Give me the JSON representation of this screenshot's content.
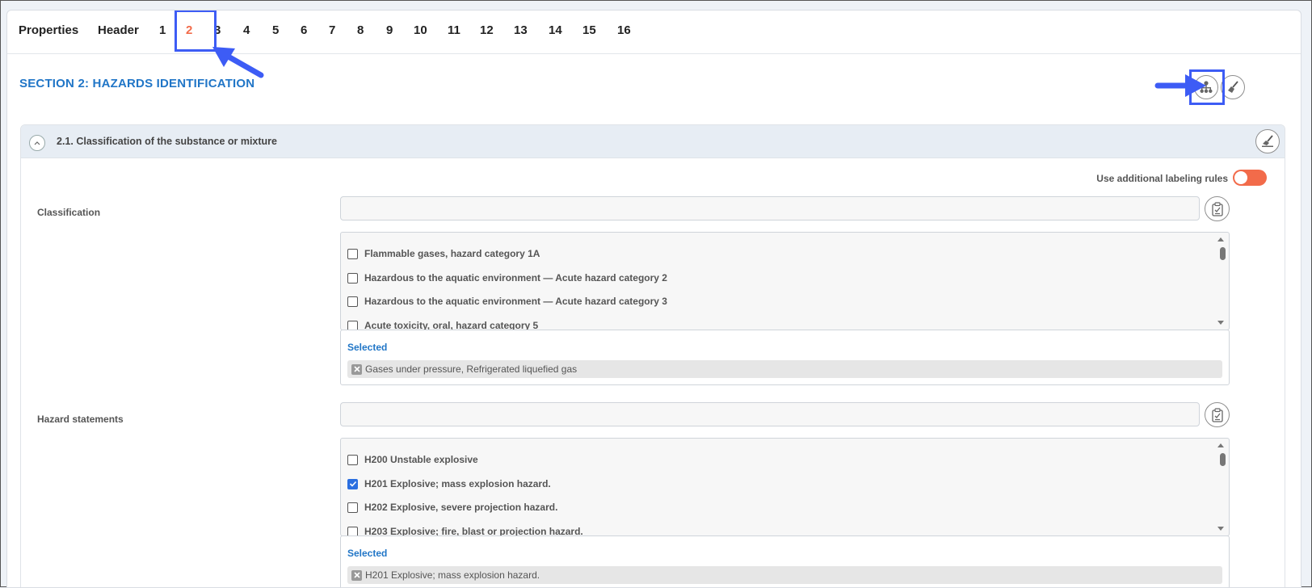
{
  "tabs": [
    {
      "label": "Properties",
      "active": false
    },
    {
      "label": "Header",
      "active": false
    },
    {
      "label": "1",
      "active": false
    },
    {
      "label": "2",
      "active": true
    },
    {
      "label": "3",
      "active": false
    },
    {
      "label": "4",
      "active": false
    },
    {
      "label": "5",
      "active": false
    },
    {
      "label": "6",
      "active": false
    },
    {
      "label": "7",
      "active": false
    },
    {
      "label": "8",
      "active": false
    },
    {
      "label": "9",
      "active": false
    },
    {
      "label": "10",
      "active": false
    },
    {
      "label": "11",
      "active": false
    },
    {
      "label": "12",
      "active": false
    },
    {
      "label": "13",
      "active": false
    },
    {
      "label": "14",
      "active": false
    },
    {
      "label": "15",
      "active": false
    },
    {
      "label": "16",
      "active": false
    }
  ],
  "section": {
    "title": "SECTION 2: HAZARDS IDENTIFICATION",
    "icons": [
      "hierarchy-icon",
      "broom-icon"
    ]
  },
  "subsection": {
    "title": "2.1. Classification of the substance or mixture",
    "toggle_label": "Use additional labeling rules",
    "toggle_on": true
  },
  "classification": {
    "label": "Classification",
    "search_value": "",
    "options": [
      {
        "label": "Flammable gases, hazard category 1A",
        "checked": false
      },
      {
        "label": "Hazardous to the aquatic environment — Acute hazard category 2",
        "checked": false
      },
      {
        "label": "Hazardous to the aquatic environment — Acute hazard category 3",
        "checked": false
      },
      {
        "label": "Acute toxicity, oral, hazard category 5",
        "checked": false
      }
    ],
    "selected_title": "Selected",
    "selected": [
      "Gases under pressure, Refrigerated liquefied gas"
    ]
  },
  "hazard_statements": {
    "label": "Hazard statements",
    "search_value": "",
    "options": [
      {
        "label": "H200 Unstable explosive",
        "checked": false
      },
      {
        "label": "H201 Explosive; mass explosion hazard.",
        "checked": true
      },
      {
        "label": "H202 Explosive, severe projection hazard.",
        "checked": false
      },
      {
        "label": "H203 Explosive; fire, blast or projection hazard.",
        "checked": false
      }
    ],
    "selected_title": "Selected",
    "selected": [
      "H201 Explosive; mass explosion hazard."
    ]
  },
  "colors": {
    "accent_blue": "#2176c7",
    "active_tab": "#f26b4a",
    "annotation": "#3d5cf5",
    "toggle_on": "#f26b4a",
    "checkbox_checked": "#2b6fe0"
  }
}
